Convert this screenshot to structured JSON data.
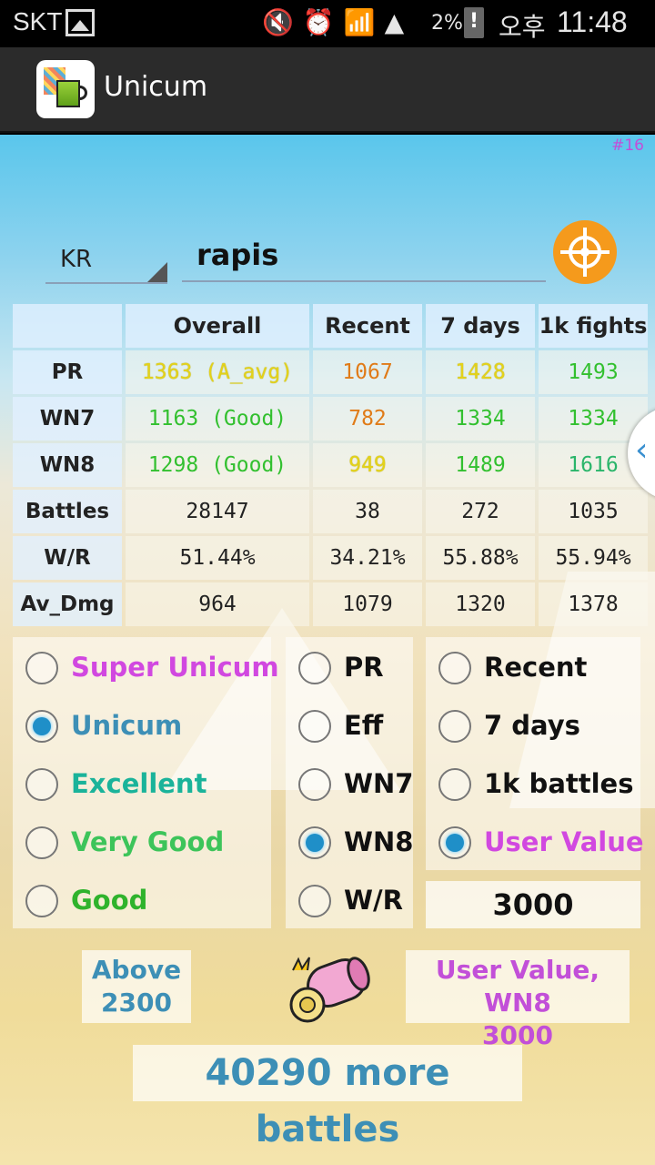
{
  "status_bar": {
    "carrier": "SKT",
    "battery_pct": "2%",
    "ampm": "오후",
    "time": "11:48",
    "icons": [
      "gallery-icon",
      "mute-icon",
      "alarm-icon",
      "wifi-icon",
      "signal-icon",
      "battery-icon"
    ]
  },
  "app": {
    "title": "Unicum"
  },
  "page_number": "#16",
  "search": {
    "server": "KR",
    "name": "rapis"
  },
  "table": {
    "headers": [
      "",
      "Overall",
      "Recent",
      "7 days",
      "1k fights"
    ],
    "rows": [
      {
        "label": "PR",
        "cells": [
          "1363 (A_avg)",
          "1067",
          "1428",
          "1493"
        ],
        "colors": [
          "yellow",
          "orange",
          "yellow",
          "green"
        ]
      },
      {
        "label": "WN7",
        "cells": [
          "1163 (Good)",
          "782",
          "1334",
          "1334"
        ],
        "colors": [
          "green",
          "orange",
          "green",
          "green"
        ]
      },
      {
        "label": "WN8",
        "cells": [
          "1298 (Good)",
          "949",
          "1489",
          "1616"
        ],
        "colors": [
          "green",
          "yellow",
          "green",
          "teal"
        ]
      },
      {
        "label": "Battles",
        "cells": [
          "28147",
          "38",
          "272",
          "1035"
        ],
        "colors": [
          "dark",
          "dark",
          "dark",
          "dark"
        ]
      },
      {
        "label": "W/R",
        "cells": [
          "51.44%",
          "34.21%",
          "55.88%",
          "55.94%"
        ],
        "colors": [
          "dark",
          "dark",
          "dark",
          "dark"
        ]
      },
      {
        "label": "Av_Dmg",
        "cells": [
          "964",
          "1079",
          "1320",
          "1378"
        ],
        "colors": [
          "dark",
          "dark",
          "dark",
          "dark"
        ]
      }
    ]
  },
  "rank_options": [
    {
      "label": "Super Unicum",
      "checked": false
    },
    {
      "label": "Unicum",
      "checked": true
    },
    {
      "label": "Excellent",
      "checked": false
    },
    {
      "label": "Very Good",
      "checked": false
    },
    {
      "label": "Good",
      "checked": false
    }
  ],
  "metric_options": [
    {
      "label": "PR",
      "checked": false
    },
    {
      "label": "Eff",
      "checked": false
    },
    {
      "label": "WN7",
      "checked": false
    },
    {
      "label": "WN8",
      "checked": true
    },
    {
      "label": "W/R",
      "checked": false
    }
  ],
  "period_options": [
    {
      "label": "Recent",
      "checked": false
    },
    {
      "label": "7 days",
      "checked": false
    },
    {
      "label": "1k battles",
      "checked": false
    },
    {
      "label": "User Value",
      "checked": true
    }
  ],
  "user_value": "3000",
  "result": {
    "above_line1": "Above",
    "above_line2": "2300",
    "target_line1": "User Value, WN8",
    "target_line2": "3000",
    "more_battles": "40290 more battles"
  },
  "colors": {
    "yellow": "#e3d21a",
    "orange": "#e07b18",
    "green": "#32c02f",
    "teal": "#2ab56a",
    "accent_orange": "#f59a1c",
    "pink": "#d148e0",
    "blue": "#3d8fb6"
  }
}
